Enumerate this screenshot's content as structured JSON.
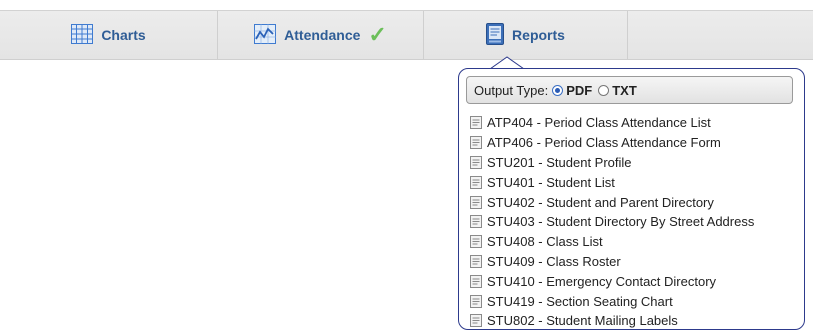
{
  "toolbar": {
    "tabs": [
      {
        "label": "Charts",
        "icon": "grid-icon"
      },
      {
        "label": "Attendance",
        "icon": "attendance-chart-icon",
        "badge": "checkmark-icon"
      },
      {
        "label": "Reports",
        "icon": "report-book-icon"
      }
    ]
  },
  "reports_menu": {
    "output_type_label": "Output Type:",
    "options": [
      "PDF",
      "TXT"
    ],
    "selected": "PDF",
    "items": [
      "ATP404 - Period Class Attendance List",
      "ATP406 - Period Class Attendance Form",
      "STU201 - Student Profile",
      "STU401 - Student List",
      "STU402 - Student and Parent Directory",
      "STU403 - Student Directory By Street Address",
      "STU408 - Class List",
      "STU409 - Class Roster",
      "STU410 - Emergency Contact Directory",
      "STU419 - Section Seating Chart",
      "STU802 - Student Mailing Labels"
    ]
  },
  "colors": {
    "tab_text": "#2f5d96",
    "popover_border": "#2d3a8c",
    "check": "#6cbf5a"
  }
}
